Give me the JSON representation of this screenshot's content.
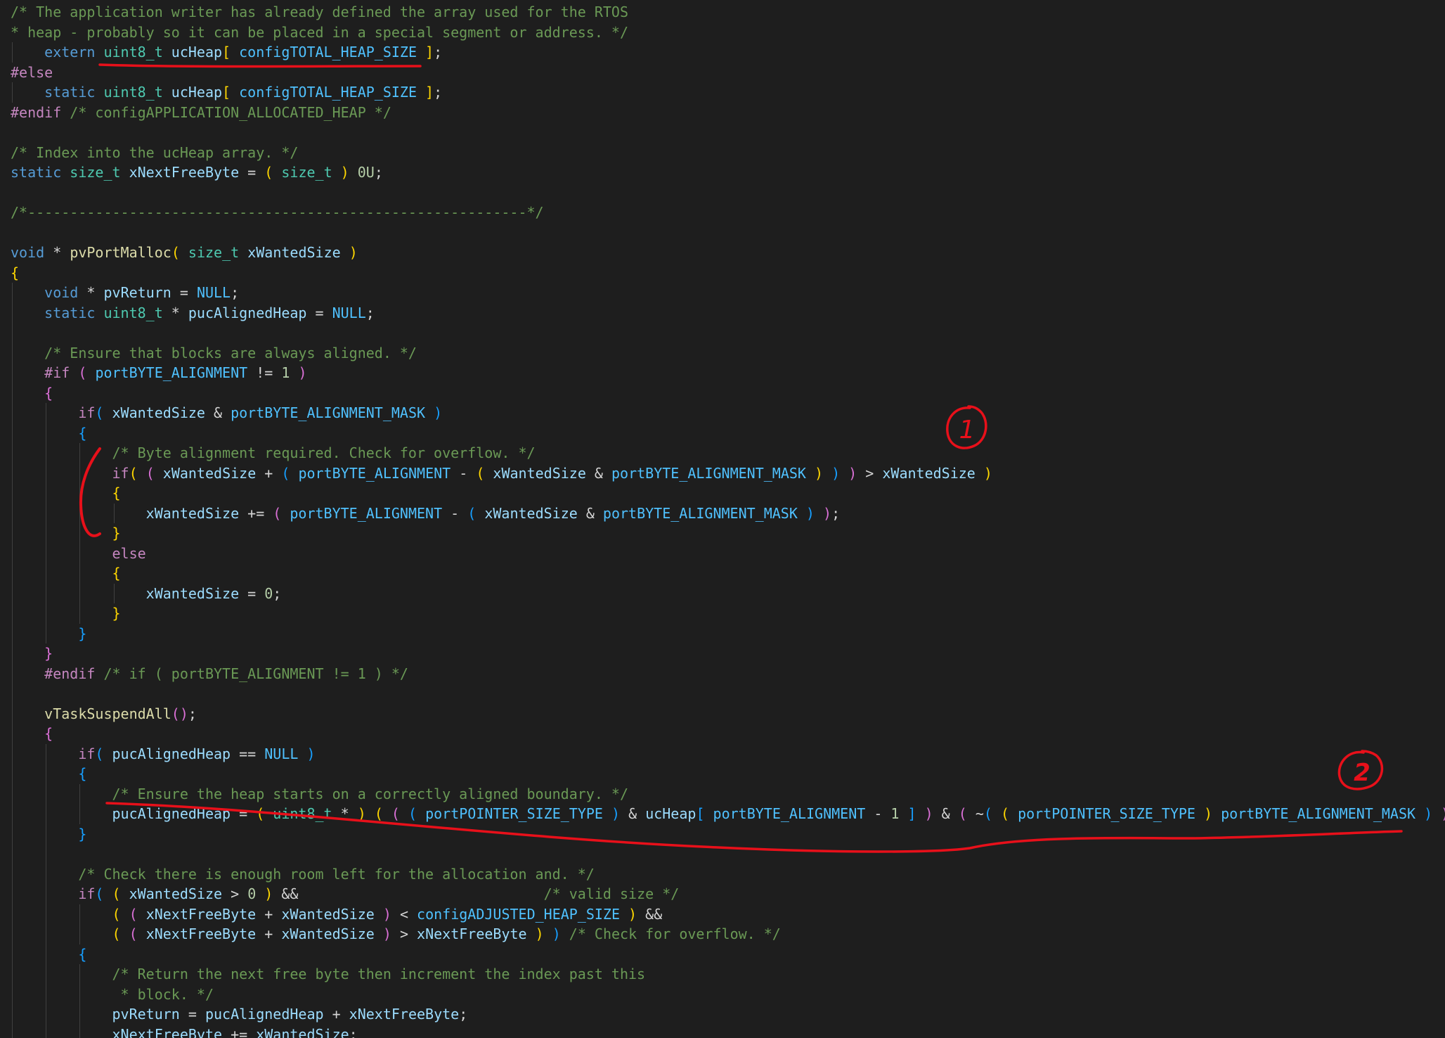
{
  "editor": {
    "colors": {
      "background": "#1e1e1e",
      "comment": "#6a9955",
      "keyword": "#569cd6",
      "type": "#4ec9b0",
      "function": "#dcdcaa",
      "variable": "#9cdcfe",
      "macro": "#4fc1ff",
      "preprocessor": "#c586c0",
      "number": "#b5cea8",
      "bracket1": "#ffd700",
      "bracket2": "#da70d6",
      "bracket3": "#179fff",
      "annotation": "#e8101a"
    },
    "lines": [
      [
        [
          "cm",
          "/* The application writer has already defined the array used for the RTOS"
        ]
      ],
      [
        [
          "cm",
          "* heap - probably so it can be placed in a special segment or address. */"
        ]
      ],
      [
        [
          "tx",
          "    "
        ],
        [
          "kw",
          "extern "
        ],
        [
          "ty",
          "uint8_t "
        ],
        [
          "vr",
          "ucHeap"
        ],
        [
          "b1",
          "[ "
        ],
        [
          "mc",
          "configTOTAL_HEAP_SIZE"
        ],
        [
          "b1",
          " ]"
        ],
        [
          "op",
          ";"
        ]
      ],
      [
        [
          "pp",
          "#else"
        ]
      ],
      [
        [
          "tx",
          "    "
        ],
        [
          "kw",
          "static "
        ],
        [
          "ty",
          "uint8_t "
        ],
        [
          "vr",
          "ucHeap"
        ],
        [
          "b1",
          "[ "
        ],
        [
          "mc",
          "configTOTAL_HEAP_SIZE"
        ],
        [
          "b1",
          " ]"
        ],
        [
          "op",
          ";"
        ]
      ],
      [
        [
          "pp",
          "#endif "
        ],
        [
          "cm",
          "/* configAPPLICATION_ALLOCATED_HEAP */"
        ]
      ],
      [],
      [
        [
          "cm",
          "/* Index into the ucHeap array. */"
        ]
      ],
      [
        [
          "kw",
          "static "
        ],
        [
          "ty",
          "size_t "
        ],
        [
          "vr",
          "xNextFreeByte"
        ],
        [
          "op",
          " = "
        ],
        [
          "b1",
          "( "
        ],
        [
          "ty",
          "size_t"
        ],
        [
          "b1",
          " ) "
        ],
        [
          "nm",
          "0U"
        ],
        [
          "op",
          ";"
        ]
      ],
      [],
      [
        [
          "cm",
          "/*-----------------------------------------------------------*/"
        ]
      ],
      [],
      [
        [
          "kw",
          "void "
        ],
        [
          "op",
          "* "
        ],
        [
          "fn",
          "pvPortMalloc"
        ],
        [
          "b1",
          "( "
        ],
        [
          "ty",
          "size_t "
        ],
        [
          "vr",
          "xWantedSize"
        ],
        [
          "b1",
          " )"
        ]
      ],
      [
        [
          "b1",
          "{"
        ]
      ],
      [
        [
          "tx",
          "    "
        ],
        [
          "kw",
          "void "
        ],
        [
          "op",
          "* "
        ],
        [
          "vr",
          "pvReturn"
        ],
        [
          "op",
          " = "
        ],
        [
          "mc",
          "NULL"
        ],
        [
          "op",
          ";"
        ]
      ],
      [
        [
          "tx",
          "    "
        ],
        [
          "kw",
          "static "
        ],
        [
          "ty",
          "uint8_t "
        ],
        [
          "op",
          "* "
        ],
        [
          "vr",
          "pucAlignedHeap"
        ],
        [
          "op",
          " = "
        ],
        [
          "mc",
          "NULL"
        ],
        [
          "op",
          ";"
        ]
      ],
      [],
      [
        [
          "tx",
          "    "
        ],
        [
          "cm",
          "/* Ensure that blocks are always aligned. */"
        ]
      ],
      [
        [
          "tx",
          "    "
        ],
        [
          "pp",
          "#if "
        ],
        [
          "b2",
          "( "
        ],
        [
          "mc",
          "portBYTE_ALIGNMENT"
        ],
        [
          "op",
          " != "
        ],
        [
          "nm",
          "1"
        ],
        [
          "b2",
          " )"
        ]
      ],
      [
        [
          "tx",
          "    "
        ],
        [
          "b2",
          "{"
        ]
      ],
      [
        [
          "tx",
          "        "
        ],
        [
          "ctl",
          "if"
        ],
        [
          "b3",
          "( "
        ],
        [
          "vr",
          "xWantedSize"
        ],
        [
          "op",
          " & "
        ],
        [
          "mc",
          "portBYTE_ALIGNMENT_MASK"
        ],
        [
          "b3",
          " )"
        ]
      ],
      [
        [
          "tx",
          "        "
        ],
        [
          "b3",
          "{"
        ]
      ],
      [
        [
          "tx",
          "            "
        ],
        [
          "cm",
          "/* Byte alignment required. Check for overflow. */"
        ]
      ],
      [
        [
          "tx",
          "            "
        ],
        [
          "ctl",
          "if"
        ],
        [
          "b1",
          "( "
        ],
        [
          "b2",
          "( "
        ],
        [
          "vr",
          "xWantedSize"
        ],
        [
          "op",
          " + "
        ],
        [
          "b3",
          "( "
        ],
        [
          "mc",
          "portBYTE_ALIGNMENT"
        ],
        [
          "op",
          " - "
        ],
        [
          "b1",
          "( "
        ],
        [
          "vr",
          "xWantedSize"
        ],
        [
          "op",
          " & "
        ],
        [
          "mc",
          "portBYTE_ALIGNMENT_MASK"
        ],
        [
          "b1",
          " )"
        ],
        [
          "b3",
          " )"
        ],
        [
          "b2",
          " )"
        ],
        [
          "op",
          " > "
        ],
        [
          "vr",
          "xWantedSize"
        ],
        [
          "b1",
          " )"
        ]
      ],
      [
        [
          "tx",
          "            "
        ],
        [
          "b1",
          "{"
        ]
      ],
      [
        [
          "tx",
          "                "
        ],
        [
          "vr",
          "xWantedSize"
        ],
        [
          "op",
          " += "
        ],
        [
          "b2",
          "( "
        ],
        [
          "mc",
          "portBYTE_ALIGNMENT"
        ],
        [
          "op",
          " - "
        ],
        [
          "b3",
          "( "
        ],
        [
          "vr",
          "xWantedSize"
        ],
        [
          "op",
          " & "
        ],
        [
          "mc",
          "portBYTE_ALIGNMENT_MASK"
        ],
        [
          "b3",
          " )"
        ],
        [
          "b2",
          " )"
        ],
        [
          "op",
          ";"
        ]
      ],
      [
        [
          "tx",
          "            "
        ],
        [
          "b1",
          "}"
        ]
      ],
      [
        [
          "tx",
          "            "
        ],
        [
          "ctl",
          "else"
        ]
      ],
      [
        [
          "tx",
          "            "
        ],
        [
          "b1",
          "{"
        ]
      ],
      [
        [
          "tx",
          "                "
        ],
        [
          "vr",
          "xWantedSize"
        ],
        [
          "op",
          " = "
        ],
        [
          "nm",
          "0"
        ],
        [
          "op",
          ";"
        ]
      ],
      [
        [
          "tx",
          "            "
        ],
        [
          "b1",
          "}"
        ]
      ],
      [
        [
          "tx",
          "        "
        ],
        [
          "b3",
          "}"
        ]
      ],
      [
        [
          "tx",
          "    "
        ],
        [
          "b2",
          "}"
        ]
      ],
      [
        [
          "tx",
          "    "
        ],
        [
          "pp",
          "#endif "
        ],
        [
          "cm",
          "/* if ( portBYTE_ALIGNMENT != 1 ) */"
        ]
      ],
      [],
      [
        [
          "tx",
          "    "
        ],
        [
          "fn",
          "vTaskSuspendAll"
        ],
        [
          "b2",
          "()"
        ],
        [
          "op",
          ";"
        ]
      ],
      [
        [
          "tx",
          "    "
        ],
        [
          "b2",
          "{"
        ]
      ],
      [
        [
          "tx",
          "        "
        ],
        [
          "ctl",
          "if"
        ],
        [
          "b3",
          "( "
        ],
        [
          "vr",
          "pucAlignedHeap"
        ],
        [
          "op",
          " == "
        ],
        [
          "mc",
          "NULL"
        ],
        [
          "b3",
          " )"
        ]
      ],
      [
        [
          "tx",
          "        "
        ],
        [
          "b3",
          "{"
        ]
      ],
      [
        [
          "tx",
          "            "
        ],
        [
          "cm",
          "/* Ensure the heap starts on a correctly aligned boundary. */"
        ]
      ],
      [
        [
          "tx",
          "            "
        ],
        [
          "vr",
          "pucAlignedHeap"
        ],
        [
          "op",
          " = "
        ],
        [
          "b1",
          "( "
        ],
        [
          "ty",
          "uint8_t"
        ],
        [
          "op",
          " * "
        ],
        [
          "b1",
          ") "
        ],
        [
          "b1",
          "( "
        ],
        [
          "b2",
          "( "
        ],
        [
          "b3",
          "( "
        ],
        [
          "mc",
          "portPOINTER_SIZE_TYPE"
        ],
        [
          "b3",
          " ) "
        ],
        [
          "op",
          "& "
        ],
        [
          "vr",
          "ucHeap"
        ],
        [
          "b3",
          "[ "
        ],
        [
          "mc",
          "portBYTE_ALIGNMENT"
        ],
        [
          "op",
          " - "
        ],
        [
          "nm",
          "1"
        ],
        [
          "b3",
          " ]"
        ],
        [
          "b2",
          " )"
        ],
        [
          "op",
          " & "
        ],
        [
          "b2",
          "( "
        ],
        [
          "op",
          "~"
        ],
        [
          "b3",
          "( "
        ],
        [
          "b1",
          "( "
        ],
        [
          "mc",
          "portPOINTER_SIZE_TYPE"
        ],
        [
          "b1",
          " ) "
        ],
        [
          "mc",
          "portBYTE_ALIGNMENT_MASK"
        ],
        [
          "b3",
          " )"
        ],
        [
          "b2",
          " )"
        ],
        [
          "b1",
          " )"
        ],
        [
          "op",
          ";"
        ]
      ],
      [
        [
          "tx",
          "        "
        ],
        [
          "b3",
          "}"
        ]
      ],
      [],
      [
        [
          "tx",
          "        "
        ],
        [
          "cm",
          "/* Check there is enough room left for the allocation and. */"
        ]
      ],
      [
        [
          "tx",
          "        "
        ],
        [
          "ctl",
          "if"
        ],
        [
          "b3",
          "( "
        ],
        [
          "b1",
          "( "
        ],
        [
          "vr",
          "xWantedSize"
        ],
        [
          "op",
          " > "
        ],
        [
          "nm",
          "0"
        ],
        [
          "b1",
          " )"
        ],
        [
          "op",
          " &&                             "
        ],
        [
          "cm",
          "/* valid size */"
        ]
      ],
      [
        [
          "tx",
          "            "
        ],
        [
          "b1",
          "( "
        ],
        [
          "b2",
          "( "
        ],
        [
          "vr",
          "xNextFreeByte"
        ],
        [
          "op",
          " + "
        ],
        [
          "vr",
          "xWantedSize"
        ],
        [
          "b2",
          " )"
        ],
        [
          "op",
          " < "
        ],
        [
          "mc",
          "configADJUSTED_HEAP_SIZE"
        ],
        [
          "b1",
          " )"
        ],
        [
          "op",
          " &&"
        ]
      ],
      [
        [
          "tx",
          "            "
        ],
        [
          "b1",
          "( "
        ],
        [
          "b2",
          "( "
        ],
        [
          "vr",
          "xNextFreeByte"
        ],
        [
          "op",
          " + "
        ],
        [
          "vr",
          "xWantedSize"
        ],
        [
          "b2",
          " )"
        ],
        [
          "op",
          " > "
        ],
        [
          "vr",
          "xNextFreeByte"
        ],
        [
          "b1",
          " )"
        ],
        [
          "b3",
          " ) "
        ],
        [
          "cm",
          "/* Check for overflow. */"
        ]
      ],
      [
        [
          "tx",
          "        "
        ],
        [
          "b3",
          "{"
        ]
      ],
      [
        [
          "tx",
          "            "
        ],
        [
          "cm",
          "/* Return the next free byte then increment the index past this"
        ]
      ],
      [
        [
          "tx",
          "             "
        ],
        [
          "cm",
          "* block. */"
        ]
      ],
      [
        [
          "tx",
          "            "
        ],
        [
          "vr",
          "pvReturn"
        ],
        [
          "op",
          " = "
        ],
        [
          "vr",
          "pucAlignedHeap"
        ],
        [
          "op",
          " + "
        ],
        [
          "vr",
          "xNextFreeByte"
        ],
        [
          "op",
          ";"
        ]
      ],
      [
        [
          "tx",
          "            "
        ],
        [
          "vr",
          "xNextFreeByte"
        ],
        [
          "op",
          " += "
        ],
        [
          "vr",
          "xWantedSize"
        ],
        [
          "op",
          ";"
        ]
      ]
    ],
    "annotations": [
      {
        "type": "circled-number",
        "text": "1"
      },
      {
        "type": "circled-number",
        "text": "2"
      }
    ]
  }
}
